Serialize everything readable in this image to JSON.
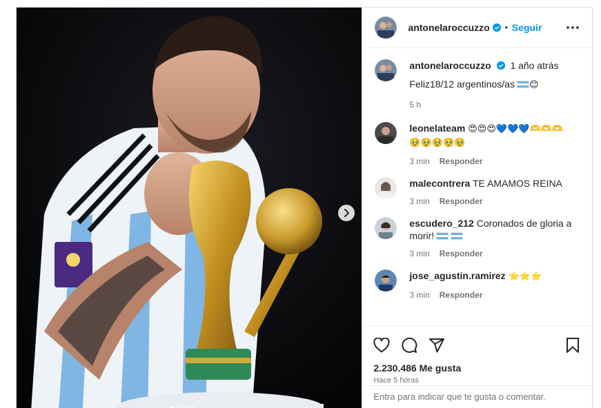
{
  "post": {
    "author": "antonelaroccuzzo",
    "follow_label": "Seguir",
    "separator": "•"
  },
  "caption": {
    "author": "antonelaroccuzzo",
    "age": "1 año atrás",
    "text": "Feliz18/12 argentinos/as",
    "time": "5 h"
  },
  "comments": [
    {
      "user": "leonelateam",
      "text": "😍😍😍💙💙💙🫶🫶🫶",
      "text2": "🥹🥹🥹🥹🥹",
      "time": "3 min",
      "reply": "Responder"
    },
    {
      "user": "malecontrera",
      "text": "TE AMAMOS REINA",
      "time": "3 min",
      "reply": "Responder"
    },
    {
      "user": "escudero_212",
      "text": "Coronados de gloria a",
      "text2": "morir!",
      "time": "3 min",
      "reply": "Responder"
    },
    {
      "user": "jose_agustin.ramirez",
      "text": "⭐⭐⭐",
      "time": "3 min",
      "reply": "Responder"
    }
  ],
  "stats": {
    "likes": "2.230.486 Me gusta",
    "ago": "Hace 5 horas"
  },
  "add_comment": {
    "placeholder": "Entra para indicar que te gusta o comentar."
  },
  "colors": {
    "accent": "#0095f6",
    "verified": "#0095f6",
    "muted": "#737373"
  }
}
